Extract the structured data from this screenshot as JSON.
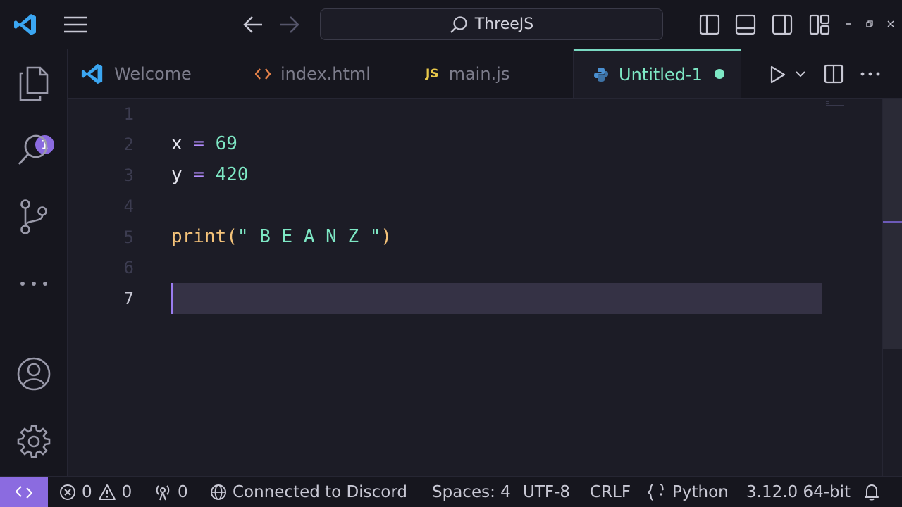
{
  "titlebar": {
    "search_text": "ThreeJS"
  },
  "activity": {
    "explorer_badge": "1"
  },
  "tabs": [
    {
      "label": "Welcome",
      "icon": "vscode-logo-icon"
    },
    {
      "label": "index.html",
      "icon": "code-brackets-icon"
    },
    {
      "label": "main.js",
      "icon": "js-file-icon",
      "icon_text": "JS"
    },
    {
      "label": "Untitled-1",
      "icon": "python-file-icon",
      "active": true,
      "dirty": true
    }
  ],
  "editor": {
    "line_numbers": [
      "1",
      "2",
      "3",
      "4",
      "5",
      "6",
      "7"
    ],
    "current_line": "7",
    "lines": {
      "l2": {
        "var": "x",
        "op": " = ",
        "value": "69"
      },
      "l3": {
        "var": "y",
        "op": " = ",
        "value": "420"
      },
      "l5": {
        "fn": "print(",
        "str": "\" B E A N Z \"",
        "close": ")"
      }
    }
  },
  "statusbar": {
    "errors": "0",
    "warnings": "0",
    "ports": "0",
    "discord": "Connected to Discord",
    "spaces": "Spaces: 4",
    "encoding": "UTF-8",
    "eol": "CRLF",
    "language": "Python",
    "interpreter": "3.12.0 64-bit"
  },
  "colors": {
    "accent": "#8b6be0",
    "teal": "#7ee8c5",
    "background": "#1c1c26"
  }
}
